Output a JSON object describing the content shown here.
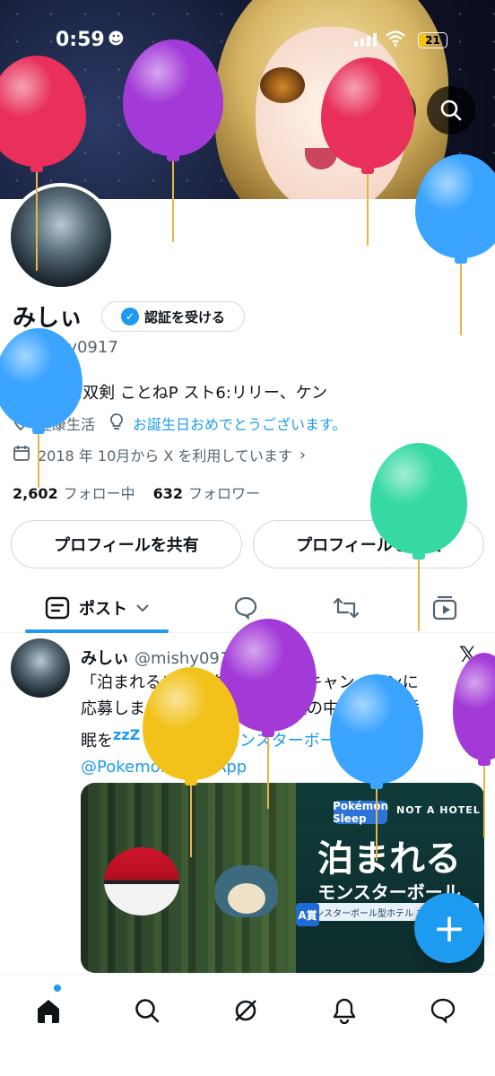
{
  "status_bar": {
    "time": "0:59",
    "battery": "21"
  },
  "profile": {
    "name": "みしぃ",
    "verify_label": "認証を受ける",
    "handle": "@mishy0917",
    "bio": "モンハン:双剣 ことねP スト6:リリー、ケン",
    "location": "健康生活",
    "birthday_text": "お誕生日おめでとうございます。",
    "joined": "2018 年 10月から X を利用しています",
    "following_count": "2,602",
    "following_label": "フォロー中",
    "followers_count": "632",
    "followers_label": "フォロワー",
    "share_button": "プロフィールを共有",
    "edit_button": "プロフィールを編集"
  },
  "tabs": {
    "posts_label": "ポスト"
  },
  "post": {
    "name": "みしぃ",
    "handle_time": "@mishy0917 · 1日",
    "text_line1": "「泊まれるモンスターボール」キャンペーンに",
    "text_line2": "応募しました！北海道の大自然の中で極上の睡",
    "text_line3a": "眠を",
    "text_zzz": "zzZ",
    "hashtag": "#泊まれるモンスターボール",
    "mention": "@PokemonSleepApp",
    "image": {
      "brand": "Pokémon Sleep",
      "hotel": "NOT A HOTEL",
      "title": "泊まれる",
      "subtitle": "モンスターボール",
      "info": "モンスターボール型ホテル 1泊2日宿泊券",
      "badge": "A賞"
    }
  },
  "colors": {
    "accent": "#1d9bf0",
    "balloon_red": "#e8305a",
    "balloon_purple": "#a33ad8",
    "balloon_blue": "#3aa4ff",
    "balloon_green": "#36d9a4",
    "balloon_yellow": "#f2c21a"
  },
  "icons": [
    "back-arrow-icon",
    "compass-icon",
    "search-icon",
    "location-icon",
    "bulb-icon",
    "calendar-icon",
    "chevron-right-icon",
    "post-icon",
    "chevron-down-icon",
    "reply-icon",
    "repost-icon",
    "video-icon",
    "x-logo-icon",
    "plus-icon",
    "home-icon",
    "notification-icon",
    "message-icon"
  ]
}
